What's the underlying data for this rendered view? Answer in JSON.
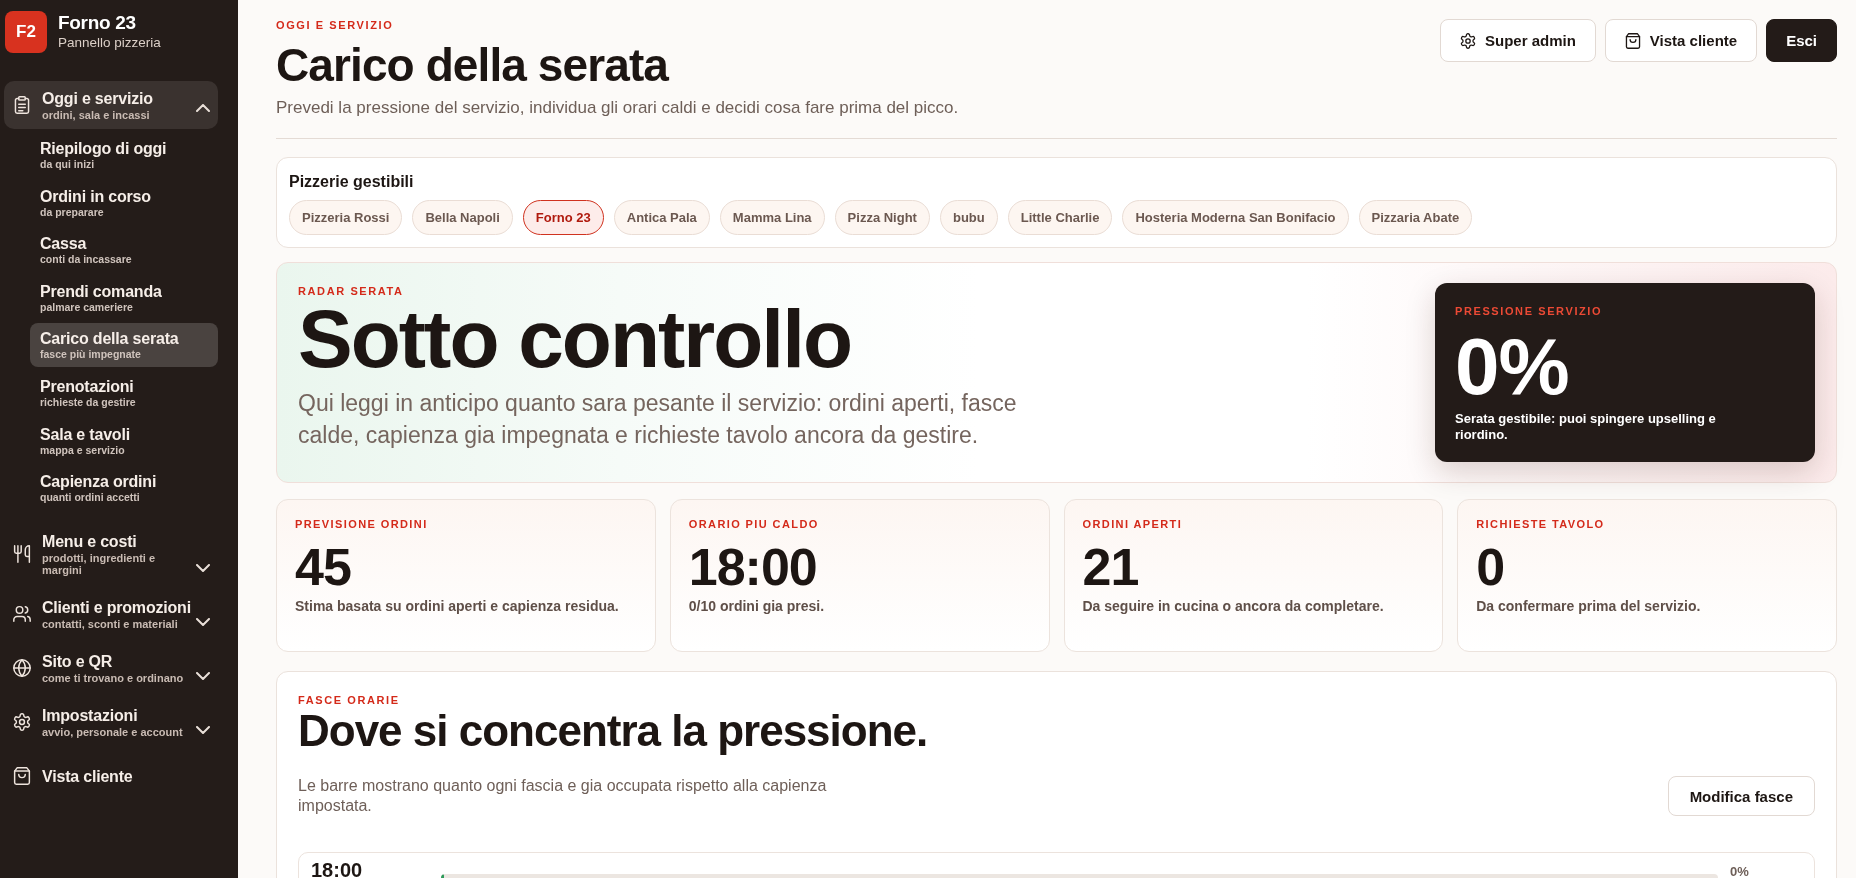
{
  "sidebar": {
    "logo": "F2",
    "brand": "Forno 23",
    "tagline": "Pannello pizzeria",
    "items": [
      {
        "kind": "group",
        "title": "Oggi e servizio",
        "subtitle": "ordini, sala e incassi",
        "selected": true,
        "expanded": true,
        "children": [
          {
            "title": "Riepilogo di oggi",
            "subtitle": "da qui inizi",
            "selected": false
          },
          {
            "title": "Ordini in corso",
            "subtitle": "da preparare",
            "selected": false
          },
          {
            "title": "Cassa",
            "subtitle": "conti da incassare",
            "selected": false
          },
          {
            "title": "Prendi comanda",
            "subtitle": "palmare cameriere",
            "selected": false
          },
          {
            "title": "Carico della serata",
            "subtitle": "fasce più impegnate",
            "selected": true
          },
          {
            "title": "Prenotazioni",
            "subtitle": "richieste da gestire",
            "selected": false
          },
          {
            "title": "Sala e tavoli",
            "subtitle": "mappa e servizio",
            "selected": false
          },
          {
            "title": "Capienza ordini",
            "subtitle": "quanti ordini accetti",
            "selected": false
          }
        ]
      },
      {
        "kind": "group",
        "title": "Menu e costi",
        "subtitle": "prodotti, ingredienti e margini",
        "selected": false,
        "expanded": false
      },
      {
        "kind": "group",
        "title": "Clienti e promozioni",
        "subtitle": "contatti, sconti e materiali",
        "selected": false,
        "expanded": false
      },
      {
        "kind": "group",
        "title": "Sito e QR",
        "subtitle": "come ti trovano e ordinano",
        "selected": false,
        "expanded": false
      },
      {
        "kind": "group",
        "title": "Impostazioni",
        "subtitle": "avvio, personale e account",
        "selected": false,
        "expanded": false
      },
      {
        "kind": "link",
        "title": "Vista cliente",
        "selected": false
      }
    ]
  },
  "header": {
    "eyebrow": "OGGI E SERVIZIO",
    "title": "Carico della serata",
    "subtitle": "Prevedi la pressione del servizio, individua gli orari caldi e decidi cosa fare prima del picco.",
    "actions": [
      {
        "label": "Super admin",
        "kind": "outline"
      },
      {
        "label": "Vista cliente",
        "kind": "outline"
      },
      {
        "label": "Esci",
        "kind": "primary"
      }
    ]
  },
  "pizzerie": {
    "label": "Pizzerie gestibili",
    "items": [
      {
        "name": "Pizzeria Rossi",
        "selected": false
      },
      {
        "name": "Bella Napoli",
        "selected": false
      },
      {
        "name": "Forno 23",
        "selected": true
      },
      {
        "name": "Antica Pala",
        "selected": false
      },
      {
        "name": "Mamma Lina",
        "selected": false
      },
      {
        "name": "Pizza Night",
        "selected": false
      },
      {
        "name": "bubu",
        "selected": false
      },
      {
        "name": "Little Charlie",
        "selected": false
      },
      {
        "name": "Hosteria Moderna San Bonifacio",
        "selected": false
      },
      {
        "name": "Pizzaria Abate",
        "selected": false
      }
    ]
  },
  "radar": {
    "eyebrow": "RADAR SERATA",
    "status": "Sotto controllo",
    "description": "Qui leggi in anticipo quanto sara pesante il servizio: ordini aperti, fasce calde, capienza gia impegnata e richieste tavolo ancora da gestire.",
    "pressure": {
      "label": "PRESSIONE SERVIZIO",
      "value": "0%",
      "note": "Serata gestibile: puoi spingere upselling e riordino."
    }
  },
  "kpis": [
    {
      "label": "PREVISIONE ORDINI",
      "value": "45",
      "note": "Stima basata su ordini aperti e capienza residua."
    },
    {
      "label": "ORARIO PIU CALDO",
      "value": "18:00",
      "note": "0/10 ordini gia presi."
    },
    {
      "label": "ORDINI APERTI",
      "value": "21",
      "note": "Da seguire in cucina o ancora da completare."
    },
    {
      "label": "RICHIESTE TAVOLO",
      "value": "0",
      "note": "Da confermare prima del servizio."
    }
  ],
  "slots": {
    "eyebrow": "FASCE ORARIE",
    "title": "Dove si concentra la pressione.",
    "description": "Le barre mostrano quanto ogni fascia e gia occupata rispetto alla capienza impostata.",
    "button": "Modifica fasce",
    "rows": [
      {
        "time": "18:00",
        "level": 0,
        "reading": "0%"
      }
    ]
  }
}
